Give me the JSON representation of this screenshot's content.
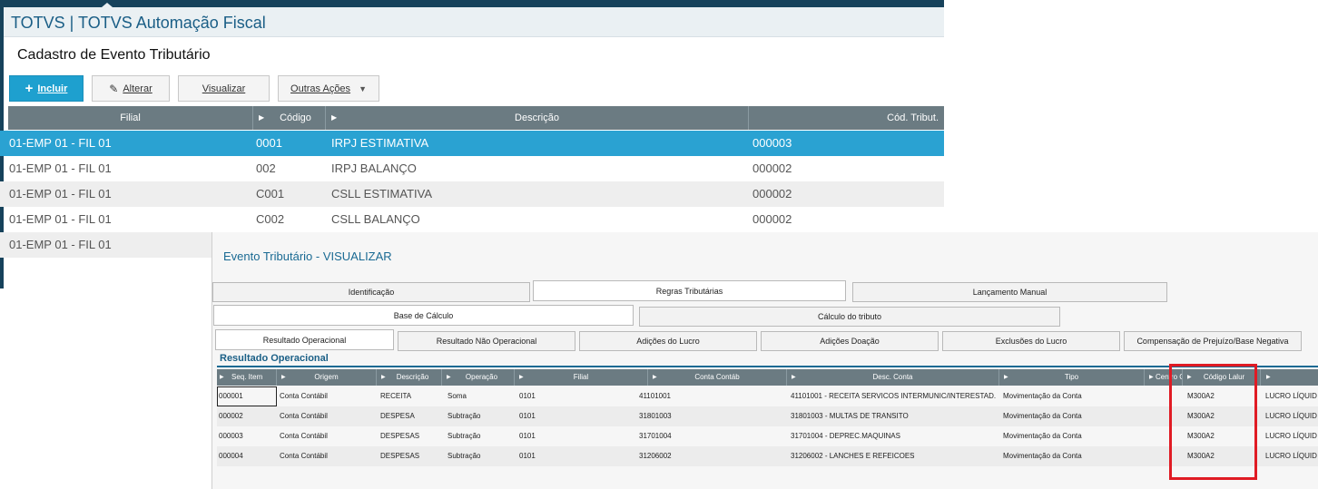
{
  "app": {
    "title": "TOTVS | TOTVS Automação Fiscal"
  },
  "page": {
    "title": "Cadastro de Evento Tributário"
  },
  "toolbar": {
    "include": "Incluir",
    "edit": "Alterar",
    "view": "Visualizar",
    "more": "Outras Ações"
  },
  "grid": {
    "columns": [
      "Filial",
      "Código",
      "Descrição",
      "Cód. Tribut."
    ],
    "rows": [
      {
        "filial": "01-EMP 01 - FIL 01",
        "codigo": "0001",
        "descricao": "IRPJ ESTIMATIVA",
        "cod_tribut": "000003"
      },
      {
        "filial": "01-EMP 01 - FIL 01",
        "codigo": "002",
        "descricao": "IRPJ BALANÇO",
        "cod_tribut": "000002"
      },
      {
        "filial": "01-EMP 01 - FIL 01",
        "codigo": "C001",
        "descricao": "CSLL ESTIMATIVA",
        "cod_tribut": "000002"
      },
      {
        "filial": "01-EMP 01 - FIL 01",
        "codigo": "C002",
        "descricao": "CSLL BALANÇO",
        "cod_tribut": "000002"
      },
      {
        "filial": "01-EMP 01 - FIL 01"
      }
    ]
  },
  "dialog": {
    "title": "Evento Tributário - VISUALIZAR",
    "tabs_l1": [
      "Identificação",
      "Regras Tributárias",
      "Lançamento Manual"
    ],
    "tabs_l2": [
      "Base de Cálculo",
      "Cálculo do tributo"
    ],
    "tabs_l3": [
      "Resultado Operacional",
      "Resultado Não Operacional",
      "Adições do Lucro",
      "Adições Doação",
      "Exclusões do Lucro",
      "Compensação de Prejuízo/Base Negativa"
    ],
    "section_title": "Resultado Operacional",
    "columns": [
      "Seq. Item",
      "Origem",
      "Descrição",
      "Operação",
      "Filial",
      "Conta Contáb",
      "Desc. Conta",
      "Tipo",
      "Centro C",
      "Código Lalur"
    ],
    "rows": [
      {
        "seq": "000001",
        "origem": "Conta Contábil",
        "descricao": "RECEITA",
        "operacao": "Soma",
        "filial": "0101",
        "conta": "41101001",
        "desc_conta": "41101001 - RECEITA SERVICOS INTERMUNIC/INTERESTAD.",
        "tipo": "Movimentação da Conta",
        "lalur": "M300A2",
        "extra": "LUCRO LÍQUID"
      },
      {
        "seq": "000002",
        "origem": "Conta Contábil",
        "descricao": "DESPESA",
        "operacao": "Subtração",
        "filial": "0101",
        "conta": "31801003",
        "desc_conta": "31801003 - MULTAS DE TRANSITO",
        "tipo": "Movimentação da Conta",
        "lalur": "M300A2",
        "extra": "LUCRO LÍQUID"
      },
      {
        "seq": "000003",
        "origem": "Conta Contábil",
        "descricao": "DESPESAS",
        "operacao": "Subtração",
        "filial": "0101",
        "conta": "31701004",
        "desc_conta": "31701004 - DEPREC.MAQUINAS",
        "tipo": "Movimentação da Conta",
        "lalur": "M300A2",
        "extra": "LUCRO LÍQUID"
      },
      {
        "seq": "000004",
        "origem": "Conta Contábil",
        "descricao": "DESPESAS",
        "operacao": "Subtração",
        "filial": "0101",
        "conta": "31206002",
        "desc_conta": "31206002 - LANCHES E REFEICOES",
        "tipo": "Movimentação da Conta",
        "lalur": "M300A2",
        "extra": "LUCRO LÍQUID"
      }
    ]
  },
  "colors": {
    "accent": "#1ea0cf",
    "selected_row": "#2aa2d2",
    "header_gray": "#6b7b82",
    "highlight": "#e01b24",
    "title_blue": "#1a5e86"
  },
  "icons": {
    "include": "plus-icon",
    "edit": "pencil-icon",
    "more": "caret-down-icon",
    "column_sort": "sort-arrow-icon"
  }
}
